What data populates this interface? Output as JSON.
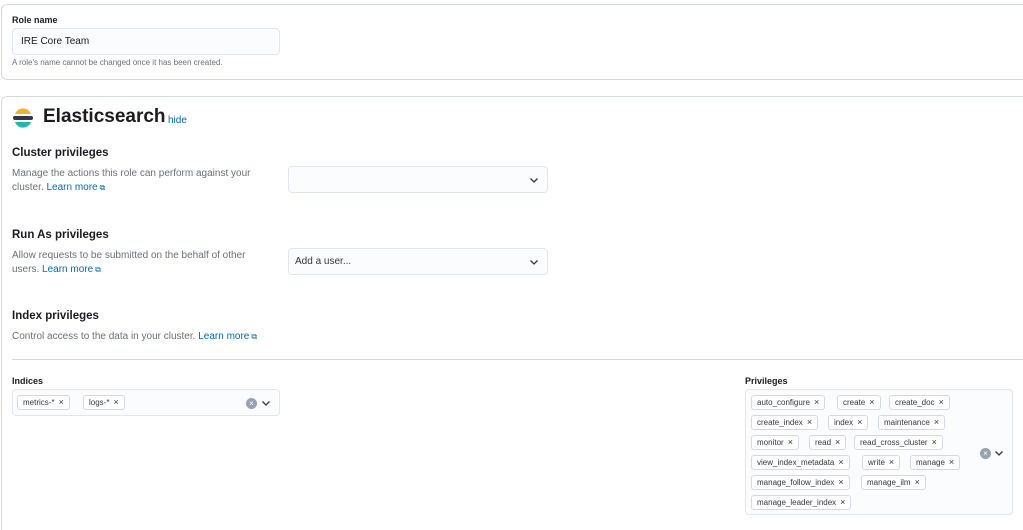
{
  "role_name": {
    "label": "Role name",
    "value": "IRE Core Team",
    "help": "A role's name cannot be changed once it has been created."
  },
  "elasticsearch": {
    "title": "Elasticsearch",
    "hide_link": "hide",
    "logo_icon": "elasticsearch-logo",
    "cluster": {
      "heading": "Cluster privileges",
      "description": "Manage the actions this role can perform against your cluster.",
      "learn_more": "Learn more",
      "select_value": ""
    },
    "run_as": {
      "heading": "Run As privileges",
      "description": "Allow requests to be submitted on the behalf of other users.",
      "learn_more": "Learn more",
      "placeholder": "Add a user..."
    },
    "index": {
      "heading": "Index privileges",
      "description": "Control access to the data in your cluster.",
      "learn_more": "Learn more",
      "indices_label": "Indices",
      "indices": [
        "metrics-*",
        "logs-*"
      ],
      "privileges_label": "Privileges",
      "privileges": [
        "auto_configure",
        "create",
        "create_doc",
        "create_index",
        "index",
        "maintenance",
        "monitor",
        "read",
        "read_cross_cluster",
        "view_index_metadata",
        "write",
        "manage",
        "manage_follow_index",
        "manage_ilm",
        "manage_leader_index"
      ]
    }
  },
  "colors": {
    "link": "#006bb8",
    "border": "#d3dae6",
    "logo_yellow": "#f0b429",
    "logo_dark": "#343741",
    "logo_teal": "#25b8a9"
  }
}
